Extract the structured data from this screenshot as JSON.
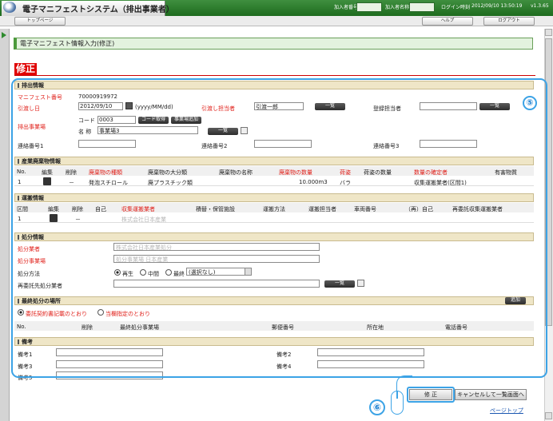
{
  "header": {
    "title": "電子マニフェストシステム（排出事業者）",
    "subscriber_no_label": "加入者番号",
    "subscriber_name_label": "加入者名称",
    "login_time_label": "ログイン時刻",
    "login_time": "2012/09/10 13:50:19",
    "version": "v1.3.65"
  },
  "nav": {
    "top": "トップページ",
    "help": "ヘルプ",
    "logout": "ログアウト"
  },
  "page": {
    "title": "電子マニフェスト情報入力(修正)",
    "mode": "修正"
  },
  "discharge": {
    "section": "排出情報",
    "manifest_no_label": "マニフェスト番号",
    "manifest_no": "70000919972",
    "delivery_date_label": "引渡し日",
    "delivery_date": "2012/09/10",
    "date_format": "(yyyy/MM/dd)",
    "delivery_person_label": "引渡し担当者",
    "delivery_person": "引渡一郎",
    "list_btn": "一覧",
    "registrant_label": "登録担当者",
    "registrant": "",
    "site_label": "排出事業場",
    "code_label": "コード",
    "code": "0003",
    "code_get_btn": "コード取得",
    "site_add_btn": "事業場追加",
    "name_label": "名 称",
    "name": "事業場3",
    "contact1_label": "連絡番号1",
    "contact2_label": "連絡番号2",
    "contact3_label": "連絡番号3"
  },
  "waste": {
    "section": "産業廃棄物情報",
    "headers": [
      "No.",
      "編集",
      "削除",
      "廃棄物の種類",
      "廃棄物の大分類",
      "廃棄物の名称",
      "廃棄物の数量",
      "荷姿",
      "荷姿の数量",
      "数量の確定者",
      "有害物質"
    ],
    "row": {
      "no": "1",
      "del": "－",
      "kind": "発泡スチロール",
      "major": "廃プラスチック類",
      "name": "",
      "qty": "10.000m3",
      "packing": "バラ",
      "packing_qty": "",
      "confirmer": "収集運搬業者(区間1)",
      "hazardous": ""
    }
  },
  "transport": {
    "section": "運搬情報",
    "headers": [
      "区間",
      "編集",
      "削除",
      "自己",
      "収集運搬業者",
      "積替・保管施設",
      "運搬方法",
      "運搬担当者",
      "車両番号",
      "（再）自己",
      "再委託収集運搬業者"
    ],
    "row": {
      "no": "1",
      "del": "－",
      "company": "株式会社日本産業"
    }
  },
  "disposal": {
    "section": "処分情報",
    "company_label": "処分業者",
    "company": "株式会社日本産業処分",
    "site_label": "処分事業場",
    "site": "処分事業場 日本産業",
    "method_label": "処分方法",
    "methods": [
      "再生",
      "中間",
      "最終"
    ],
    "method_select": "(選択なし)",
    "recontract_label": "再委託先処分業者",
    "list_btn": "一覧"
  },
  "final": {
    "section": "最終処分の場所",
    "add_btn": "追加",
    "options": [
      "委託契約書記載のとおり",
      "当欄指定のとおり"
    ],
    "headers": [
      "No.",
      "削除",
      "最終処分事業場",
      "郵便番号",
      "所在地",
      "電話番号"
    ]
  },
  "remarks": {
    "section": "備考",
    "labels": [
      "備考1",
      "備考2",
      "備考3",
      "備考4",
      "備考5"
    ]
  },
  "actions": {
    "modify": "修 正",
    "cancel": "キャンセルして一覧画面へ",
    "page_top": "ページトップ"
  },
  "callouts": {
    "five": "⑤",
    "six": "⑥"
  },
  "colors": {
    "accent_green": "#2e7d32",
    "required_red": "#e0201a",
    "highlight_blue": "#3ca3e6",
    "section_tan": "#efe6c7"
  }
}
